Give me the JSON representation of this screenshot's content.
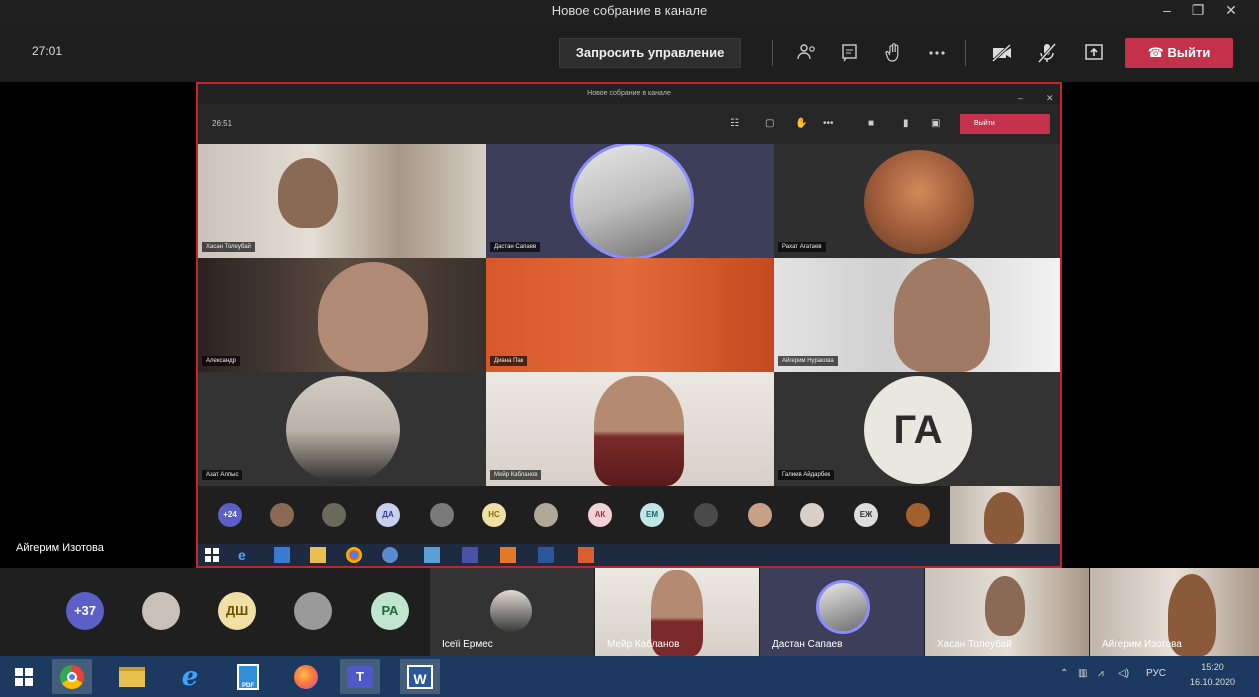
{
  "window": {
    "title": "Новое собрание в канале",
    "min": "–",
    "max": "❐",
    "close": "✕"
  },
  "meeting": {
    "timer": "27:01",
    "request_control": "Запросить управление",
    "leave": "Выйти",
    "presenter_name": "Айгерим Изотова"
  },
  "shared_screen": {
    "title": "Новое собрание в канале",
    "timer": "26:51",
    "leave": "Выйти",
    "tiles": [
      {
        "name": "Хасан Толеубай"
      },
      {
        "name": "Дастан Сапаев"
      },
      {
        "name": "Рахат Агатаев"
      },
      {
        "name": "Александр"
      },
      {
        "name": "Диана Пак"
      },
      {
        "name": "Айгерим Нуракова"
      },
      {
        "name": "Азат Алпыс"
      },
      {
        "name": "Мейр Кабланов"
      },
      {
        "name": "Галиев Айдарбек",
        "initials": "ГА"
      }
    ],
    "strip_avatars": [
      "+24",
      "",
      "",
      "ДА",
      "",
      "НС",
      "",
      "АК",
      "ЕМ",
      "",
      "",
      "",
      "ЕЖ",
      ""
    ]
  },
  "bottom_strip": {
    "overflow_count": "+37",
    "avatars": [
      {
        "initials": "",
        "color": "#c9c0b8"
      },
      {
        "initials": "ДШ",
        "color": "#f1e0a6"
      },
      {
        "initials": "",
        "color": "#9a9a9a"
      },
      {
        "initials": "РА",
        "color": "#bfe5cf"
      }
    ],
    "tiles": [
      {
        "name": "Ісеїі Ермес"
      },
      {
        "name": "Мейр Кабланов"
      },
      {
        "name": "Дастан Сапаев"
      },
      {
        "name": "Хасан Толеубай"
      },
      {
        "name": "Айгерим Изотова"
      }
    ]
  },
  "taskbar": {
    "lang": "РУС",
    "time": "15:20",
    "date": "16.10.2020"
  }
}
